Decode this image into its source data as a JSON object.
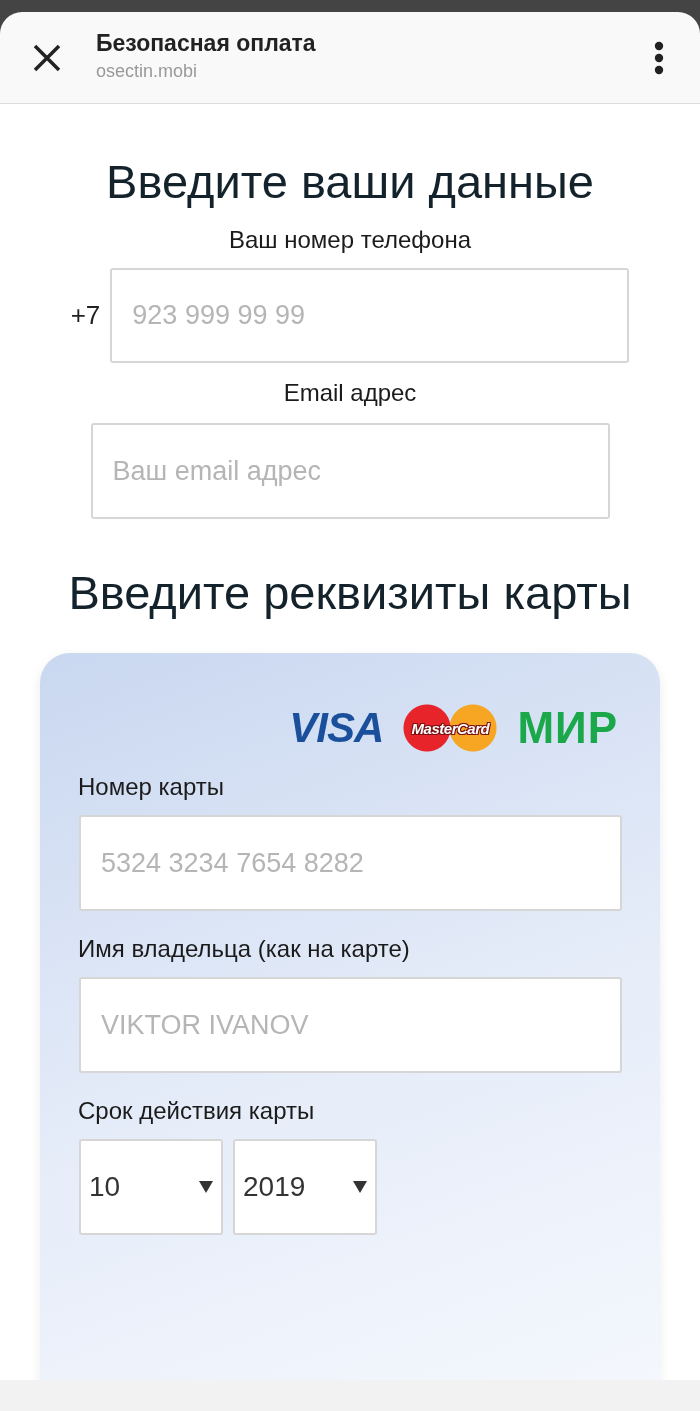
{
  "header": {
    "title": "Безопасная оплата",
    "url": "osectin.mobi"
  },
  "contact": {
    "heading": "Введите ваши данные",
    "phone": {
      "label": "Ваш номер телефона",
      "prefix": "+7",
      "placeholder": "923 999 99 99"
    },
    "email": {
      "label": "Email адрес",
      "placeholder": "Ваш email адрес"
    }
  },
  "card": {
    "heading": "Введите реквизиты карты",
    "brands": [
      {
        "kind": "visa",
        "text": "VISA"
      },
      {
        "kind": "mastercard",
        "text": "MasterCard"
      },
      {
        "kind": "mir",
        "text": "МИР"
      }
    ],
    "fields": [
      {
        "label": "Номер карты",
        "placeholder": "5324 3234 7654 8282"
      },
      {
        "label": "Имя владельца (как на карте)",
        "placeholder": "VIKTOR IVANOV"
      }
    ],
    "expiry": {
      "label": "Срок действия карты",
      "month": "10",
      "year": "2019"
    }
  }
}
